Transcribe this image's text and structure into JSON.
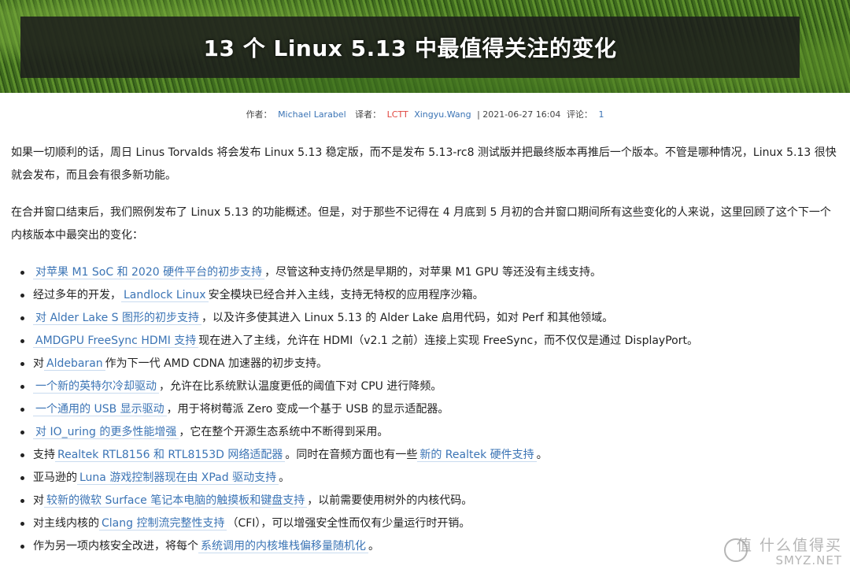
{
  "hero": {
    "title": "13 个 Linux 5.13 中最值得关注的变化"
  },
  "meta": {
    "author_label": "作者：",
    "author": "Michael Larabel",
    "translator_label": "译者：",
    "source": "LCTT",
    "translator": "Xingyu.Wang",
    "date": "| 2021-06-27 16:04",
    "comments_label": "评论：",
    "comments_count": "1"
  },
  "intro": [
    "如果一切顺利的话，周日 Linus Torvalds 将会发布 Linux 5.13 稳定版，而不是发布 5.13-rc8 测试版并把最终版本再推后一个版本。不管是哪种情况，Linux 5.13 很快就会发布，而且会有很多新功能。",
    "在合并窗口结束后，我们照例发布了 Linux 5.13 的功能概述。但是，对于那些不记得在 4 月底到 5 月初的合并窗口期间所有这些变化的人来说，这里回顾了这个下一个内核版本中最突出的变化："
  ],
  "items": [
    {
      "pre": "",
      "link": "对苹果 M1 SoC 和 2020 硬件平台的初步支持",
      "post": "，尽管这种支持仍然是早期的，对苹果 M1 GPU 等还没有主线支持。"
    },
    {
      "pre": "经过多年的开发，",
      "link": "Landlock Linux",
      "post": "安全模块已经合并入主线，支持无特权的应用程序沙箱。"
    },
    {
      "pre": "",
      "link": "对 Alder Lake S 图形的初步支持",
      "post": "，以及许多使其进入 Linux 5.13 的 Alder Lake 启用代码，如对 Perf 和其他领域。"
    },
    {
      "pre": "",
      "link": "AMDGPU FreeSync HDMI 支持",
      "post": "现在进入了主线，允许在 HDMI（v2.1 之前）连接上实现 FreeSync，而不仅仅是通过 DisplayPort。"
    },
    {
      "pre": "对",
      "link": "Aldebaran",
      "post": "作为下一代 AMD CDNA 加速器的初步支持。"
    },
    {
      "pre": "",
      "link": "一个新的英特尔冷却驱动",
      "post": "，允许在比系统默认温度更低的阈值下对 CPU 进行降频。"
    },
    {
      "pre": "",
      "link": "一个通用的 USB 显示驱动",
      "post": "，用于将树莓派 Zero 变成一个基于 USB 的显示适配器。"
    },
    {
      "pre": "",
      "link": "对 IO_uring 的更多性能增强",
      "post": "，它在整个开源生态系统中不断得到采用。"
    },
    {
      "pre": "支持",
      "link": "Realtek RTL8156 和 RTL8153D 网络适配器",
      "post": "。同时在音频方面也有一些",
      "link2": "新的 Realtek 硬件支持",
      "post2": "。"
    },
    {
      "pre": "亚马逊的",
      "link": "Luna 游戏控制器现在由 XPad 驱动支持",
      "post": "。"
    },
    {
      "pre": "对",
      "link": "较新的微软 Surface 笔记本电脑的触摸板和键盘支持",
      "post": "，以前需要使用树外的内核代码。"
    },
    {
      "pre": "对主线内核的",
      "link": "Clang 控制流完整性支持",
      "post": "（CFI），可以增强安全性而仅有少量运行时开销。"
    },
    {
      "pre": "作为另一项内核安全改进，将每个",
      "link": "系统调用的内核堆栈偏移量随机化",
      "post": "。"
    }
  ],
  "watermark": {
    "line1": "值 什么值得买",
    "line2": "SMYZ.NET"
  }
}
